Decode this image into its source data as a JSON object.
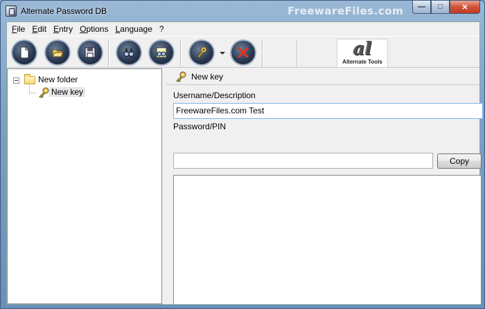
{
  "window": {
    "title": "Alternate Password DB",
    "watermark": "FreewareFiles.com",
    "controls": {
      "minimize": "—",
      "maximize": "□",
      "close": "✕"
    }
  },
  "menu": [
    {
      "label": "File",
      "underline": "F",
      "rest": "ile"
    },
    {
      "label": "Edit",
      "underline": "E",
      "rest": "dit"
    },
    {
      "label": "Entry",
      "underline": "E",
      "rest": "ntry"
    },
    {
      "label": "Options",
      "underline": "O",
      "rest": "ptions"
    },
    {
      "label": "Language",
      "underline": "L",
      "rest": "anguage"
    },
    {
      "label": "?",
      "underline": "",
      "rest": "?"
    }
  ],
  "toolbar": {
    "buttons": [
      {
        "name": "new-file-button",
        "icon": "new-document-icon"
      },
      {
        "name": "open-button",
        "icon": "open-folder-icon"
      },
      {
        "name": "save-button",
        "icon": "floppy-disk-icon"
      },
      {
        "name": "search-button",
        "icon": "binoculars-icon"
      },
      {
        "name": "search-next-button",
        "icon": "binoculars-next-icon"
      },
      {
        "name": "new-key-button",
        "icon": "key-icon"
      },
      {
        "name": "delete-button",
        "icon": "red-x-icon"
      }
    ],
    "logo_mark": "al",
    "logo_text": "Alternate Tools"
  },
  "tree": {
    "folder_label": "New folder",
    "key_label": "New key"
  },
  "detail": {
    "title": "New key",
    "username_label": "Username/Description",
    "username_value": "FreewareFiles.com Test",
    "password_label": "Password/PIN",
    "password_value": "",
    "copy_label": "Copy"
  },
  "colors": {
    "titlebar": "#7c9fc4",
    "close_button": "#c23a22",
    "toolbar_button": "#2b3a52"
  }
}
